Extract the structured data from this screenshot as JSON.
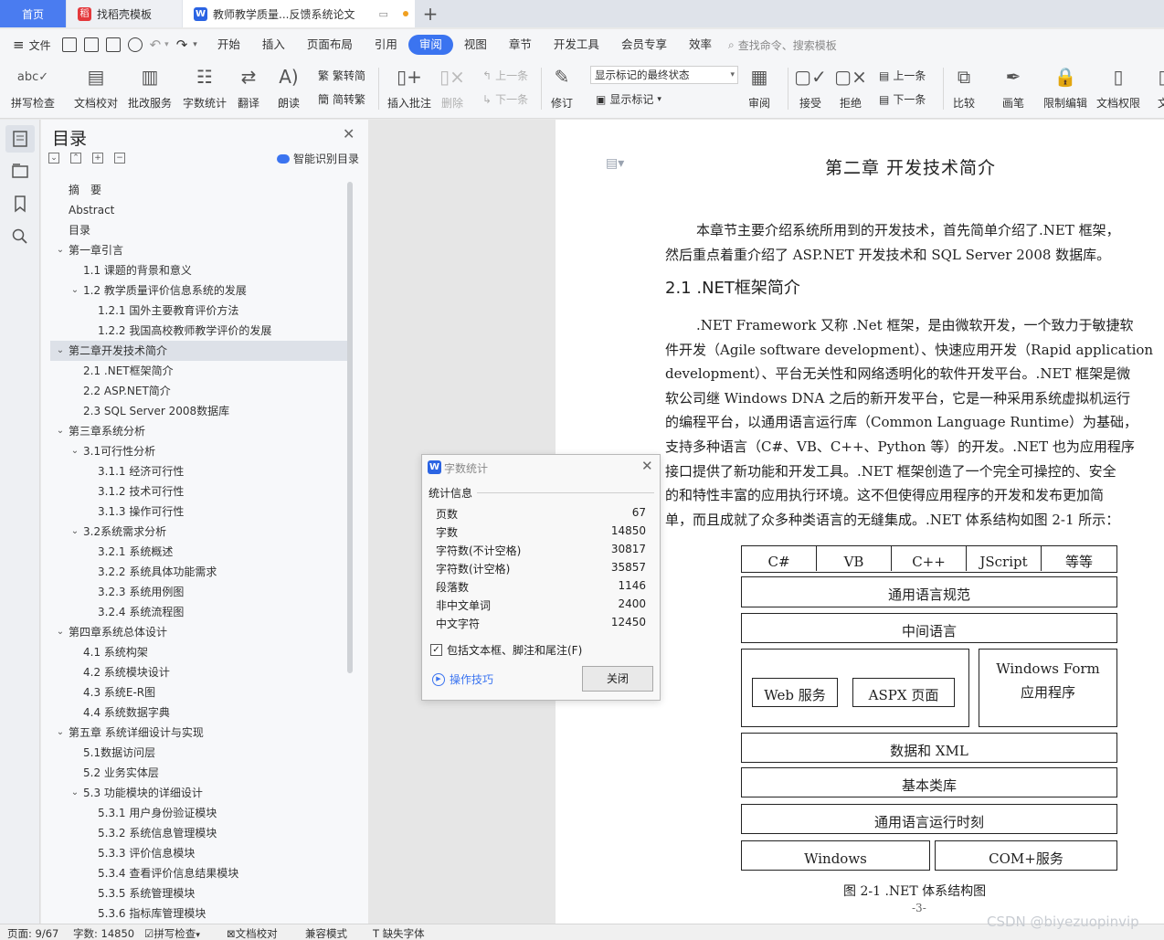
{
  "tabs": {
    "home": "首页",
    "templates": "找稻壳模板",
    "document": "教师教学质量...反馈系统论文"
  },
  "menu": {
    "file": "文件",
    "items": [
      "开始",
      "插入",
      "页面布局",
      "引用",
      "审阅",
      "视图",
      "章节",
      "开发工具",
      "会员专享",
      "效率"
    ],
    "active": "审阅",
    "search": "查找命令、搜索模板"
  },
  "ribbon": {
    "spell_check": "拼写检查",
    "doc_proof": "文档校对",
    "batch_service": "批改服务",
    "word_count": "字数统计",
    "translate": "翻译",
    "read_aloud": "朗读",
    "trad_to_simp": "繁转简",
    "simp_to_trad": "简转繁",
    "insert_comment": "插入批注",
    "delete": "删除",
    "prev_comment": "上一条",
    "next_comment": "下一条",
    "track": "修订",
    "markup_state": "显示标记的最终状态",
    "show_markup": "显示标记",
    "review": "审阅",
    "accept": "接受",
    "reject": "拒绝",
    "prev_change": "上一条",
    "next_change": "下一条",
    "compare": "比较",
    "pen": "画笔",
    "restrict_edit": "限制编辑",
    "doc_permission": "文档权限",
    "more": "文"
  },
  "toc": {
    "title": "目录",
    "smart": "智能识别目录",
    "items": [
      {
        "label": "摘　要",
        "level": 1,
        "chev": ""
      },
      {
        "label": "Abstract",
        "level": 1,
        "chev": ""
      },
      {
        "label": "目录",
        "level": 1,
        "chev": ""
      },
      {
        "label": "第一章引言",
        "level": 1,
        "chev": "v"
      },
      {
        "label": "1.1  课题的背景和意义",
        "level": 2,
        "chev": ""
      },
      {
        "label": "1.2  教学质量评价信息系统的发展",
        "level": 2,
        "chev": "v"
      },
      {
        "label": "1.2.1  国外主要教育评价方法",
        "level": 3,
        "chev": ""
      },
      {
        "label": "1.2.2 我国高校教师教学评价的发展",
        "level": 3,
        "chev": ""
      },
      {
        "label": "第二章开发技术简介",
        "level": 1,
        "chev": "v",
        "active": true
      },
      {
        "label": "2.1 .NET框架简介",
        "level": 2,
        "chev": ""
      },
      {
        "label": "2.2 ASP.NET简介",
        "level": 2,
        "chev": ""
      },
      {
        "label": "2.3 SQL Server 2008数据库",
        "level": 2,
        "chev": ""
      },
      {
        "label": "第三章系统分析",
        "level": 1,
        "chev": "v"
      },
      {
        "label": "3.1可行性分析",
        "level": 2,
        "chev": "v"
      },
      {
        "label": "3.1.1  经济可行性",
        "level": 3,
        "chev": ""
      },
      {
        "label": "3.1.2  技术可行性",
        "level": 3,
        "chev": ""
      },
      {
        "label": "3.1.3  操作可行性",
        "level": 3,
        "chev": ""
      },
      {
        "label": "3.2系统需求分析",
        "level": 2,
        "chev": "v"
      },
      {
        "label": "3.2.1  系统概述",
        "level": 3,
        "chev": ""
      },
      {
        "label": "3.2.2  系统具体功能需求",
        "level": 3,
        "chev": ""
      },
      {
        "label": "3.2.3  系统用例图",
        "level": 3,
        "chev": ""
      },
      {
        "label": "3.2.4 系统流程图",
        "level": 3,
        "chev": ""
      },
      {
        "label": "第四章系统总体设计",
        "level": 1,
        "chev": "v"
      },
      {
        "label": "4.1  系统构架",
        "level": 2,
        "chev": ""
      },
      {
        "label": "4.2  系统模块设计",
        "level": 2,
        "chev": ""
      },
      {
        "label": "4.3  系统E-R图",
        "level": 2,
        "chev": ""
      },
      {
        "label": "4.4  系统数据字典",
        "level": 2,
        "chev": ""
      },
      {
        "label": "第五章  系统详细设计与实现",
        "level": 1,
        "chev": "v"
      },
      {
        "label": "5.1数据访问层",
        "level": 2,
        "chev": ""
      },
      {
        "label": "5.2  业务实体层",
        "level": 2,
        "chev": ""
      },
      {
        "label": "5.3  功能模块的详细设计",
        "level": 2,
        "chev": "v"
      },
      {
        "label": "5.3.1  用户身份验证模块",
        "level": 3,
        "chev": ""
      },
      {
        "label": "5.3.2 系统信息管理模块",
        "level": 3,
        "chev": ""
      },
      {
        "label": "5.3.3  评价信息模块",
        "level": 3,
        "chev": ""
      },
      {
        "label": "5.3.4  查看评价信息结果模块",
        "level": 3,
        "chev": ""
      },
      {
        "label": "5.3.5  系统管理模块",
        "level": 3,
        "chev": ""
      },
      {
        "label": "5.3.6  指标库管理模块",
        "level": 3,
        "chev": ""
      }
    ]
  },
  "document": {
    "chapter_title": "第二章  开发技术简介",
    "intro_lines": [
      "本章节主要介绍系统所用到的开发技术，首先简单介绍了.NET 框架，",
      "然后重点着重介绍了 ASP.NET 开发技术和 SQL Server 2008 数据库。"
    ],
    "section_title": "2.1  .NET框架简介",
    "body_lines": [
      ".NET Framework 又称  .Net 框架，是由微软开发，一个致力于敏捷软",
      "件开发（Agile software development）、快速应用开发（Rapid application",
      "development）、平台无关性和网络透明化的软件开发平台。.NET 框架是微",
      "软公司继 Windows DNA 之后的新开发平台，它是一种采用系统虚拟机运行",
      "的编程平台，以通用语言运行库（Common Language Runtime）为基础，",
      "支持多种语言（C#、VB、C++、Python 等）的开发。.NET 也为应用程序",
      "接口提供了新功能和开发工具。.NET 框架创造了一个完全可操控的、安全",
      "的和特性丰富的应用执行环境。这不但使得应用程序的开发和发布更加简",
      "单，而且成就了众多种类语言的无缝集成。.NET 体系结构如图 2-1 所示："
    ],
    "diagram": {
      "languages": [
        "C#",
        "VB",
        "C++",
        "JScript",
        "等等"
      ],
      "cls": "通用语言规范",
      "il": "中间语言",
      "web_service": "Web 服务",
      "aspx_page": "ASPX 页面",
      "winforms": "Windows Form",
      "winforms_sub": "应用程序",
      "data_xml": "数据和 XML",
      "base_class": "基本类库",
      "clr": "通用语言运行时刻",
      "windows": "Windows",
      "com": "COM+服务"
    },
    "figure_caption": "图 2-1  .NET 体系结构图",
    "page_number": "-3-"
  },
  "dialog": {
    "title": "字数统计",
    "section": "统计信息",
    "rows": [
      {
        "label": "页数",
        "value": "67"
      },
      {
        "label": "字数",
        "value": "14850"
      },
      {
        "label": "字符数(不计空格)",
        "value": "30817"
      },
      {
        "label": "字符数(计空格)",
        "value": "35857"
      },
      {
        "label": "段落数",
        "value": "1146"
      },
      {
        "label": "非中文单词",
        "value": "2400"
      },
      {
        "label": "中文字符",
        "value": "12450"
      }
    ],
    "checkbox": "包括文本框、脚注和尾注(F)",
    "tips": "操作技巧",
    "close": "关闭"
  },
  "status": {
    "page": "页面: 9/67",
    "words": "字数: 14850",
    "spell": "拼写检查",
    "proof": "文档校对",
    "compat": "兼容模式",
    "missing_font": "缺失字体"
  },
  "watermark": "CSDN @biyezuopinvip"
}
